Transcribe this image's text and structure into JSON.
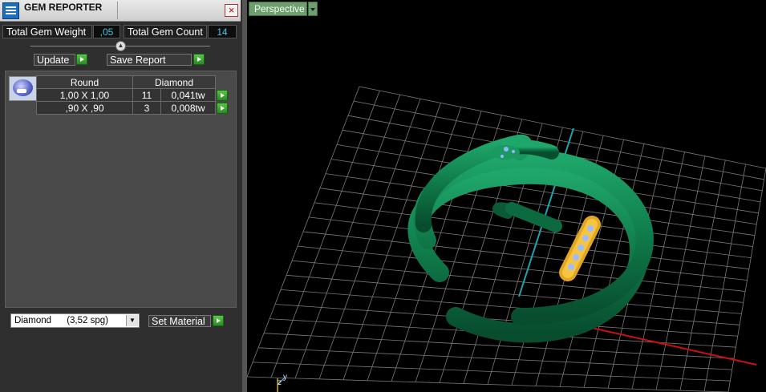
{
  "window": {
    "title": "GEM REPORTER"
  },
  "totals": {
    "weight_label": "Total Gem Weight",
    "weight_value": ",05",
    "count_label": "Total Gem Count",
    "count_value": "14"
  },
  "toolbar": {
    "update_label": "Update",
    "save_report_label": "Save Report"
  },
  "gem_table": {
    "headers": [
      "Round",
      "Diamond"
    ],
    "rows": [
      {
        "size": "1,00 X 1,00",
        "count": "11",
        "weight": "0,041tw"
      },
      {
        "size": ",90 X ,90",
        "count": "3",
        "weight": "0,008tw"
      }
    ]
  },
  "material": {
    "selected": "Diamond      (3,52 spg)",
    "set_label": "Set Material"
  },
  "viewport": {
    "view_name": "Perspective",
    "axis_y": "y",
    "axis_z": "z"
  },
  "colors": {
    "accent_green": "#3aa82f",
    "value_cyan": "#39c9e6",
    "model_green": "#0f7a4a",
    "gold": "#e3a622"
  }
}
